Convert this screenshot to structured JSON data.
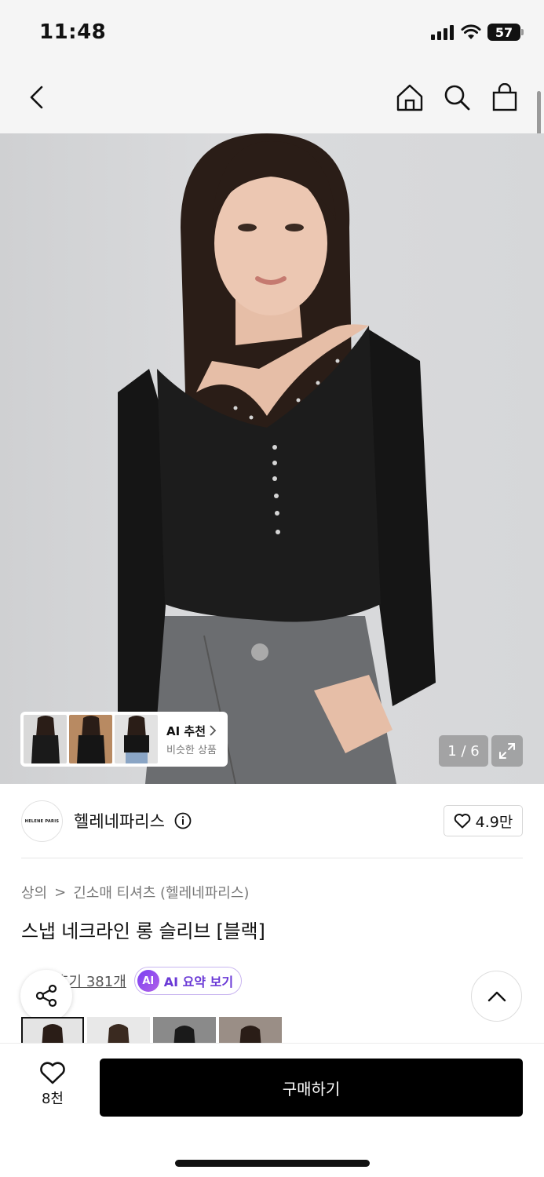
{
  "status_bar": {
    "time": "11:48",
    "battery": "57"
  },
  "hero": {
    "ai_recommend_title": "AI 추천",
    "ai_recommend_subtitle": "비슷한 상품",
    "image_counter": "1 / 6"
  },
  "brand": {
    "logo_text": "HELENE PARIS",
    "name": "헬레네파리스",
    "likes": "4.9만"
  },
  "breadcrumb": {
    "category": "상의",
    "separator": ">",
    "subcategory": "긴소매 티셔츠 (헬레네파리스)"
  },
  "product": {
    "title": "스냅 네크라인 롱 슬리브 [블랙]"
  },
  "reviews": {
    "count_label": "후기 381개",
    "ai_summary_badge": "AI",
    "ai_summary_label": "AI 요약 보기"
  },
  "bottom": {
    "wish_count": "8천",
    "buy_label": "구매하기"
  },
  "colors": {
    "accent_purple": "#6a39d6",
    "buy_button": "#000000"
  }
}
